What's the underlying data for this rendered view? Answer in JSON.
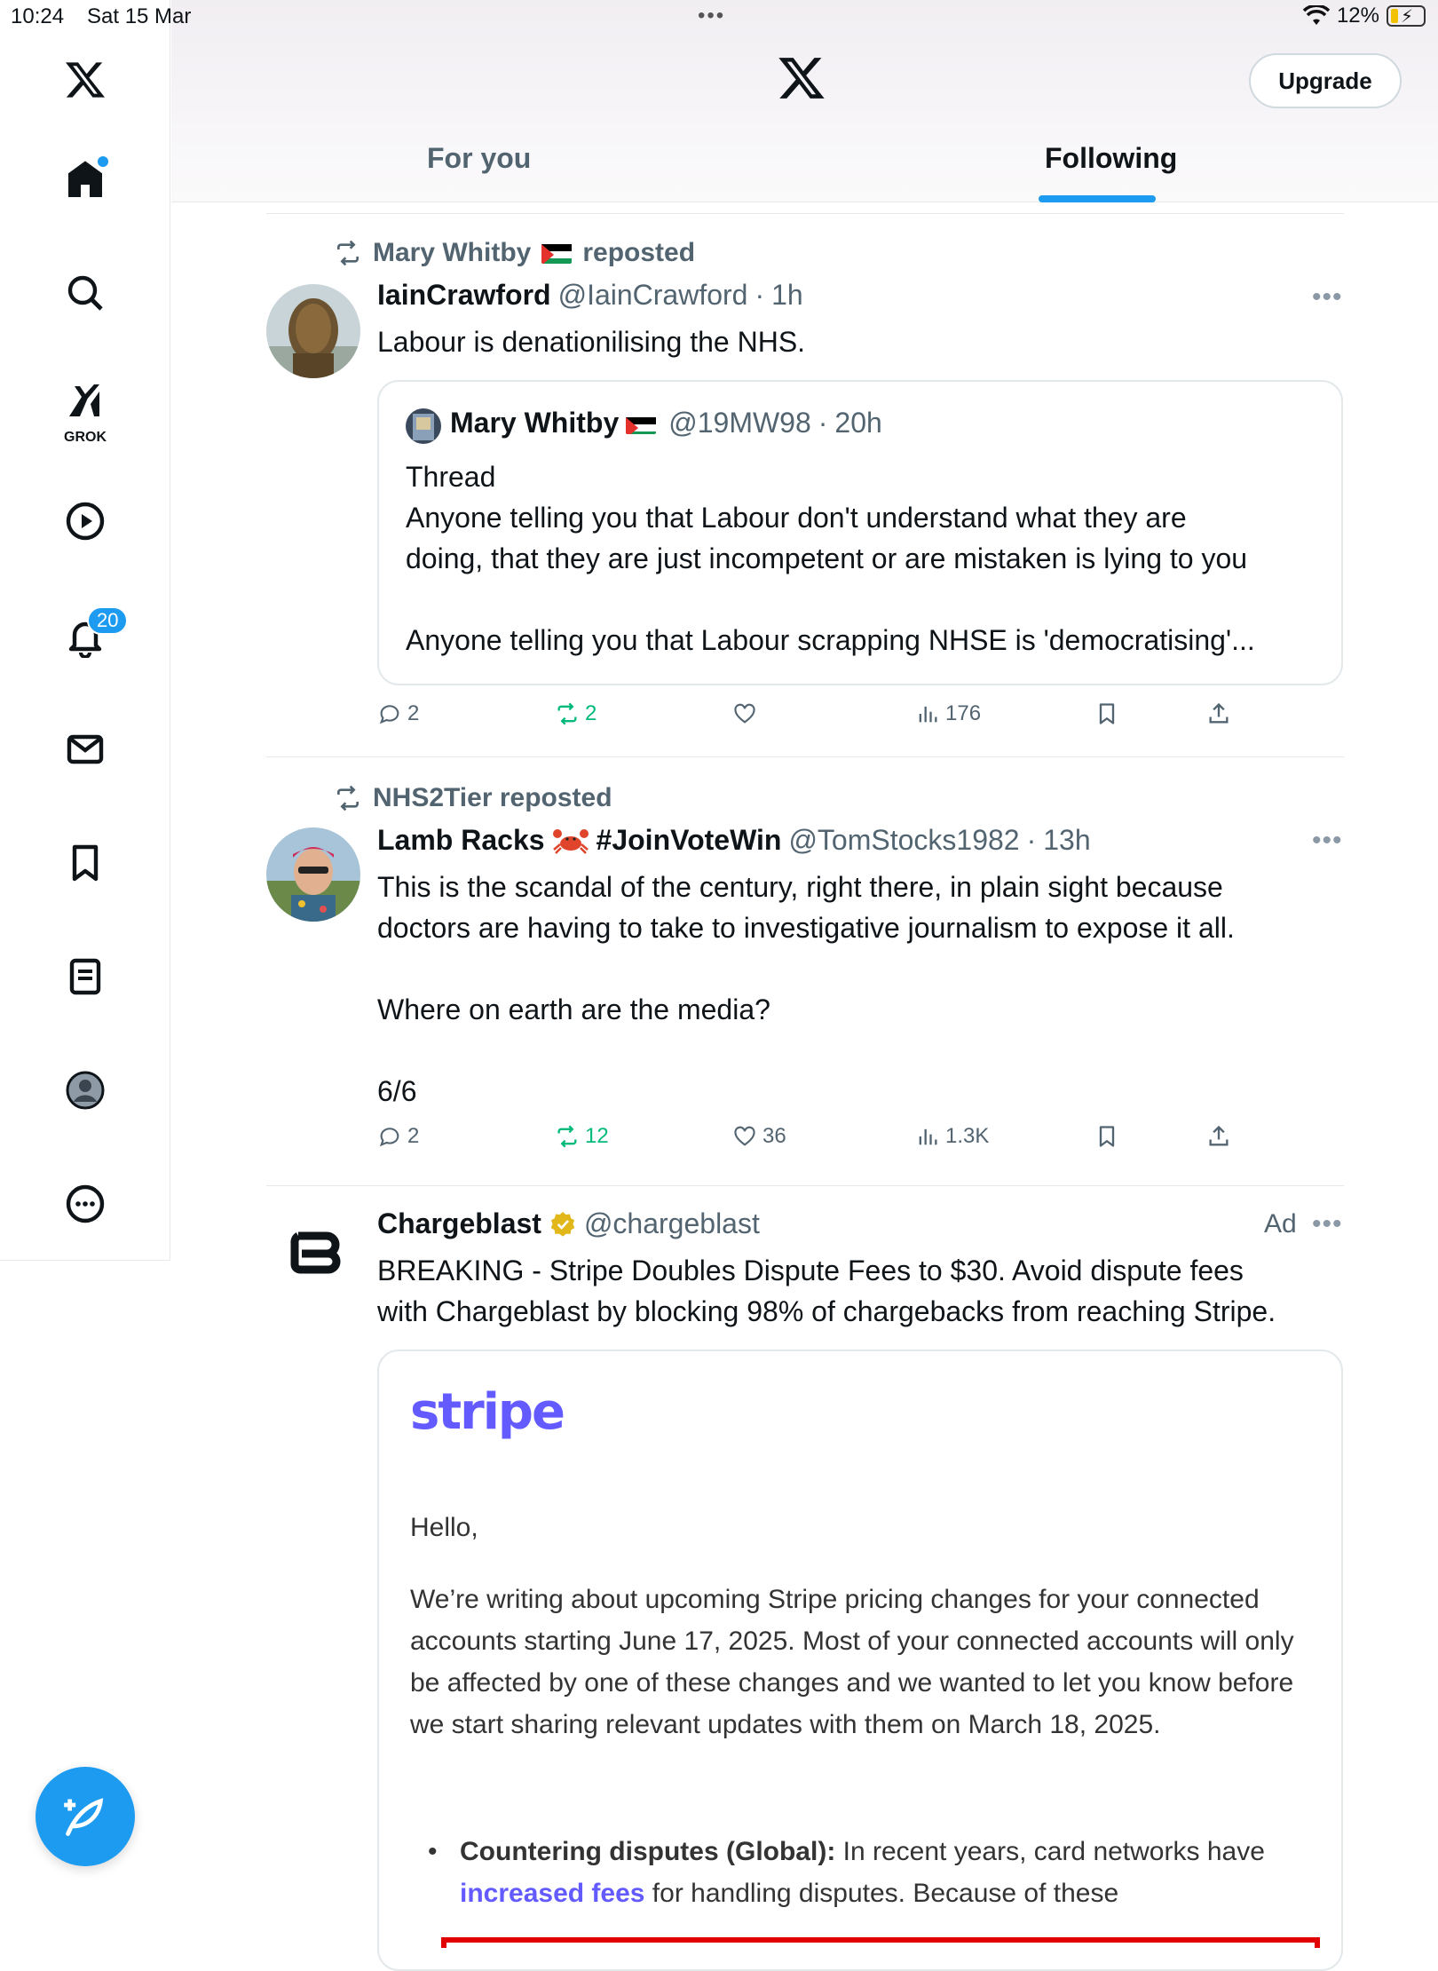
{
  "status_bar": {
    "time": "10:24",
    "date": "Sat 15 Mar",
    "battery": "12%"
  },
  "sidebar": {
    "notifications_badge": "20",
    "grok_label": "GROK",
    "items": [
      "x-logo",
      "home-icon",
      "search-icon",
      "grok-icon",
      "video-icon",
      "notifications-icon",
      "messages-icon",
      "bookmarks-icon",
      "lists-icon",
      "profile-icon",
      "more-icon"
    ]
  },
  "header": {
    "upgrade_label": "Upgrade",
    "tabs": [
      {
        "label": "For you"
      },
      {
        "label": "Following"
      }
    ]
  },
  "feed": {
    "post1": {
      "repost_by": "Mary Whitby",
      "repost_suffix": "reposted",
      "name": "IainCrawford",
      "handle": "@IainCrawford",
      "time": "1h",
      "text": "Labour is denationilising the NHS.",
      "quote": {
        "name": "Mary Whitby",
        "handle": "@19MW98",
        "time": "20h",
        "line1": "Thread",
        "line2": "Anyone telling you that Labour don't understand what they are",
        "line3": "doing, that they are just incompetent  or are mistaken is lying to you",
        "line4": "Anyone telling you that Labour scrapping NHSE is 'democratising'..."
      },
      "replies": "2",
      "reposts": "2",
      "likes": "",
      "views": "176"
    },
    "post2": {
      "repost_by": "NHS2Tier reposted",
      "name": "Lamb Racks",
      "hashtag": "#JoinVoteWin",
      "handle": "@TomStocks1982",
      "time": "13h",
      "text_line1": "This is the scandal of the century, right there, in plain sight because",
      "text_line2": "doctors are having to take to investigative journalism to expose it all.",
      "text_line3": "Where on earth are the media?",
      "text_line4": "6/6",
      "replies": "2",
      "reposts": "12",
      "likes": "36",
      "views": "1.3K"
    },
    "post3": {
      "name": "Chargeblast",
      "handle": "@chargeblast",
      "ad_label": "Ad",
      "text_line1": "BREAKING - Stripe Doubles Dispute Fees to $30. Avoid dispute fees",
      "text_line2": "with Chargeblast by blocking 98% of chargebacks from reaching Stripe.",
      "card": {
        "brand": "stripe",
        "hello": "Hello,",
        "paragraph": "We’re writing about upcoming Stripe pricing changes for your connected accounts starting June 17, 2025. Most of your connected accounts will only be affected by one of these changes and we wanted to let you know before we start sharing relevant updates with them on March 18, 2025.",
        "bullet_title": "Countering disputes (Global):",
        "bullet_text1": " In recent years, card networks have ",
        "bullet_link": "increased fees",
        "bullet_text2": " for handling disputes. Because of these"
      }
    }
  }
}
